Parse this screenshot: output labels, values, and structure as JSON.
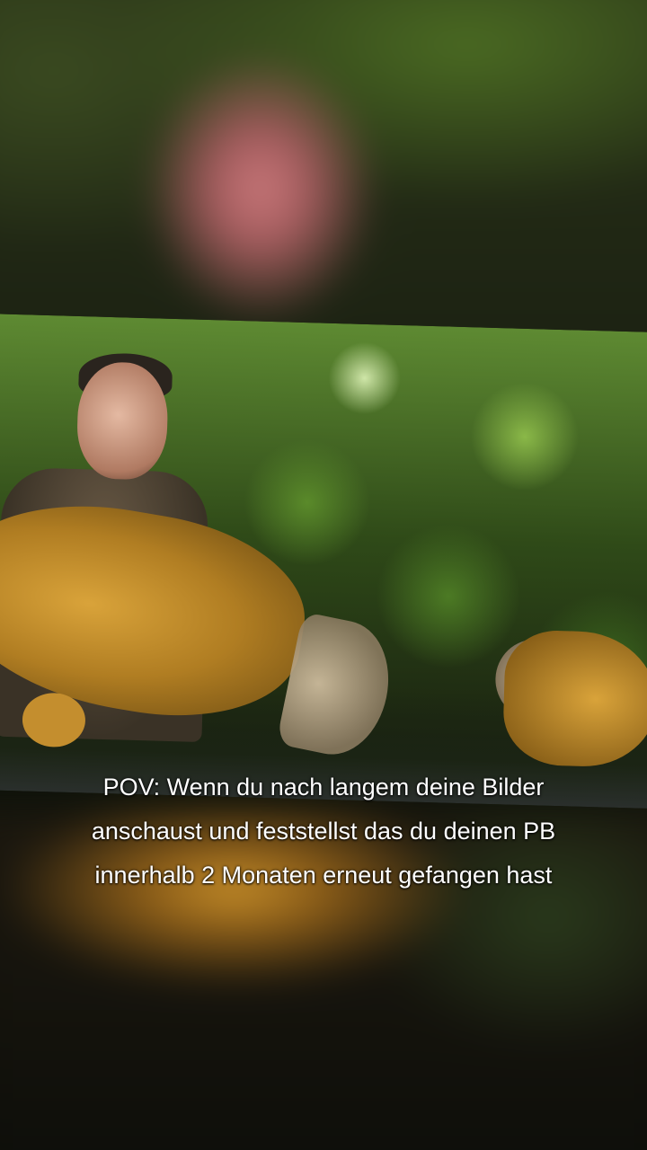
{
  "caption": {
    "line1": "POV: Wenn du nach langem deine Bilder",
    "line2": "anschaust und feststellst das du deinen PB",
    "line3": "innerhalb 2 Monaten erneut gefangen hast"
  },
  "colors": {
    "caption_text": "#ffffff",
    "foliage": "#4c7a24",
    "carp": "#d9a33a"
  }
}
